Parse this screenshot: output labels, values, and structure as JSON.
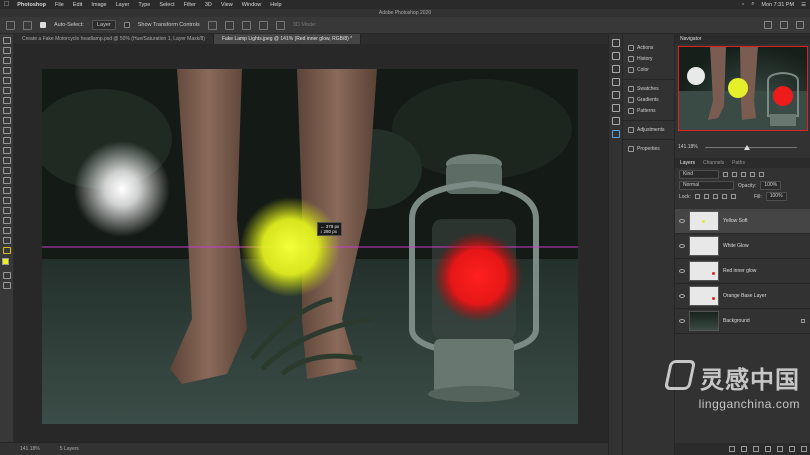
{
  "menubar": {
    "app": "Photoshop",
    "items": [
      "File",
      "Edit",
      "Image",
      "Layer",
      "Type",
      "Select",
      "Filter",
      "3D",
      "View",
      "Window",
      "Help"
    ],
    "clock": "Mon 7:31 PM"
  },
  "window_title": "Adobe Photoshop 2020",
  "options": {
    "auto_select_label": "Auto-Select:",
    "auto_select_value": "Layer",
    "show_transform_label": "Show Transform Controls",
    "mode_3d_label": "3D Mode:"
  },
  "tabs": [
    {
      "label": "Create a Fake Motorcycle headlamp.psd @ 50% (Hue/Saturation 1, Layer Mask/8)"
    },
    {
      "label": "Fake Lamp Lights.jpeg @ 141% (Red inner glow, RGB/8) *"
    }
  ],
  "canvas": {
    "measure_line1": "↔ 378 px",
    "measure_line2": "↕ 280 px"
  },
  "status": {
    "zoom": "141.18%",
    "layers_count": "5 Layers"
  },
  "panels_collapsed": [
    {
      "label": "Actions",
      "icon": "play-icon"
    },
    {
      "label": "History",
      "icon": "history-icon"
    },
    {
      "label": "Color",
      "icon": "color-icon"
    },
    {
      "label": "Swatches",
      "icon": "grid-icon"
    },
    {
      "label": "Gradients",
      "icon": "gradient-icon"
    },
    {
      "label": "Patterns",
      "icon": "pattern-icon"
    },
    {
      "label": "Adjustments",
      "icon": "adjust-icon"
    },
    {
      "label": "Properties",
      "icon": "properties-icon"
    }
  ],
  "navigator": {
    "title": "Navigator",
    "zoom": "141.18%",
    "zoom_fraction": 0.46
  },
  "layers_panel": {
    "tabs": [
      "Layers",
      "Channels",
      "Paths"
    ],
    "filter_label": "Kind",
    "blend_mode": "Normal",
    "opacity_label": "Opacity:",
    "opacity_value": "100%",
    "lock_label": "Lock:",
    "fill_label": "Fill:",
    "fill_value": "100%",
    "layers": [
      {
        "name": "Yellow Soft",
        "selected": true,
        "dot": "#e6ec3a"
      },
      {
        "name": "White Glow",
        "selected": false,
        "dot": ""
      },
      {
        "name": "Red inner glow",
        "selected": false,
        "dot": "#e02424"
      },
      {
        "name": "Orange Base Layer",
        "selected": false,
        "dot": "#e02424"
      },
      {
        "name": "Background",
        "selected": false,
        "dot": "",
        "locked": true
      }
    ]
  },
  "watermark": {
    "cn": "灵感中国",
    "en": "lingganchina.com"
  },
  "colors": {
    "yellow_glow": "#e6ef2a",
    "red_glow": "#ff1a1a",
    "white_glow": "#ffffff",
    "guide": "#c83ac8"
  }
}
